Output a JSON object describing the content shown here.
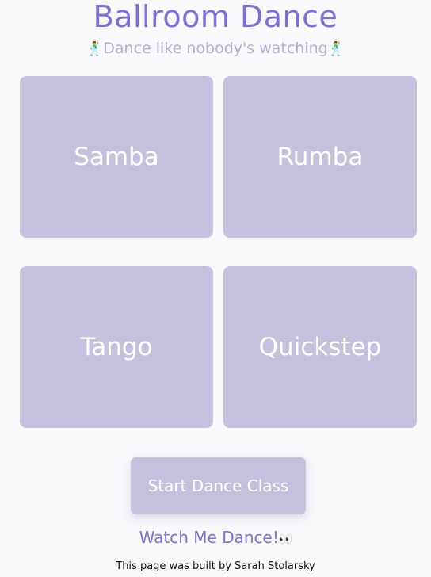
{
  "header": {
    "title": "Ballroom Dance",
    "subtitle": "Dance like nobody's watching",
    "subtitle_emoji": "🕺"
  },
  "dances": [
    {
      "label": "Samba"
    },
    {
      "label": "Rumba"
    },
    {
      "label": "Tango"
    },
    {
      "label": "Quickstep"
    }
  ],
  "actions": {
    "start_button": "Start Dance Class",
    "watch_link": "Watch Me Dance!",
    "watch_emoji": "👀"
  },
  "footer": {
    "text": "This page was built by Sarah Stolarsky"
  },
  "colors": {
    "title": "#7a70d8",
    "subtitle": "#b3acd8",
    "tile": "#c4c1df",
    "background": "#f9f8fb"
  }
}
